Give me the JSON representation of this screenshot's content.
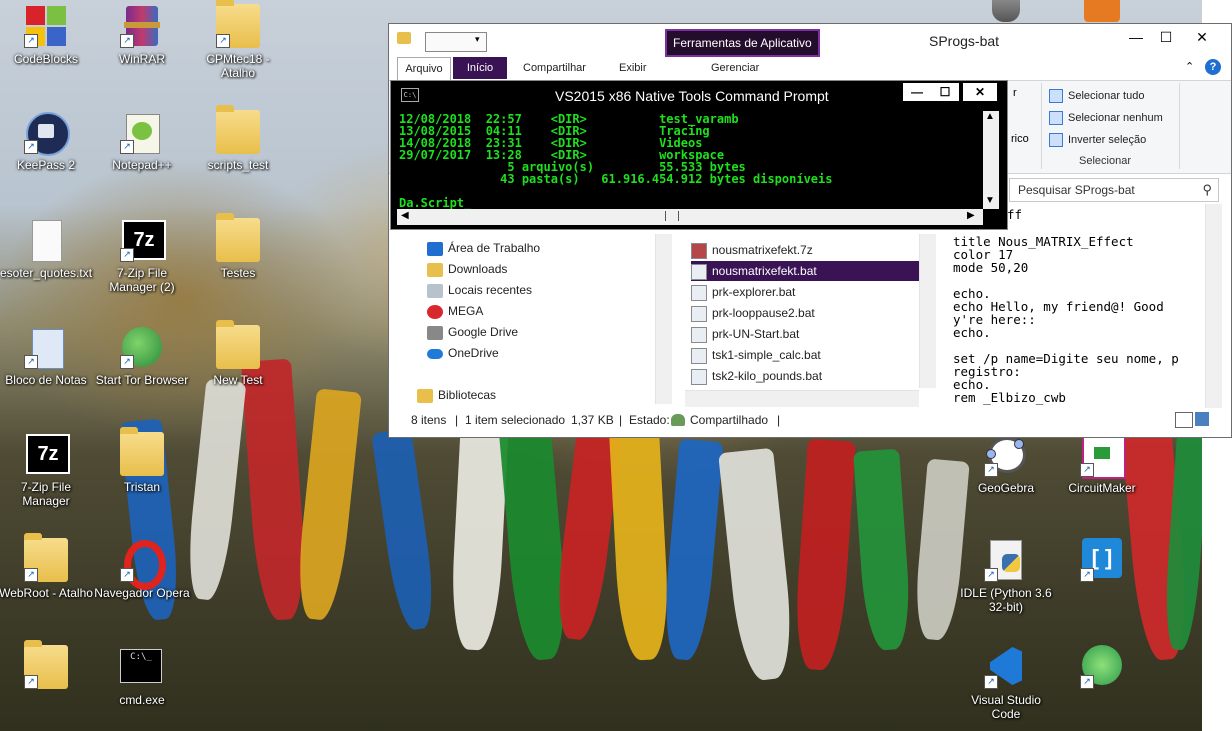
{
  "desktop": {
    "icons": [
      {
        "label": "CodeBlocks"
      },
      {
        "label": "WinRAR"
      },
      {
        "label": "CPMtec18 - Atalho"
      },
      {
        "label": "KeePass 2"
      },
      {
        "label": "Notepad++"
      },
      {
        "label": "scripts_test"
      },
      {
        "label": "esoter_quotes.txt"
      },
      {
        "label": "7-Zip File Manager (2)"
      },
      {
        "label": "Testes"
      },
      {
        "label": "Bloco de Notas"
      },
      {
        "label": "Start Tor Browser"
      },
      {
        "label": "New Test"
      },
      {
        "label": "7-Zip File Manager"
      },
      {
        "label": "Tristan"
      },
      {
        "label": "WebRoot - Atalho"
      },
      {
        "label": "Navegador Opera"
      },
      {
        "label": "cmd.exe"
      },
      {
        "label": "GeoGebra"
      },
      {
        "label": "CircuitMaker"
      },
      {
        "label": "IDLE (Python 3.6 32-bit)"
      },
      {
        "label": "Visual Studio Code"
      }
    ]
  },
  "explorer": {
    "title": "SProgs-bat",
    "tool_tab": "Ferramentas de Aplicativo",
    "tabs": [
      "Arquivo",
      "Início",
      "Compartilhar",
      "Exibir",
      "Gerenciar"
    ],
    "ribbon_select": {
      "select_all": "Selecionar tudo",
      "select_none": "Selecionar nenhum",
      "invert": "Inverter seleção",
      "group": "Selecionar",
      "partial_1": "r",
      "partial_2": "rico"
    },
    "search_placeholder": "Pesquisar SProgs-bat",
    "nav": [
      "Área de Trabalho",
      "Downloads",
      "Locais recentes",
      "MEGA",
      "Google Drive",
      "OneDrive",
      "Bibliotecas"
    ],
    "files": [
      {
        "name": "nousmatrixefekt.7z",
        "selected": false
      },
      {
        "name": "nousmatrixefekt.bat",
        "selected": true
      },
      {
        "name": "prk-explorer.bat",
        "selected": false
      },
      {
        "name": "prk-looppause2.bat",
        "selected": false
      },
      {
        "name": "prk-UN-Start.bat",
        "selected": false
      },
      {
        "name": "tsk1-simple_calc.bat",
        "selected": false
      },
      {
        "name": "tsk2-kilo_pounds.bat",
        "selected": false
      }
    ],
    "preview": [
      "ff",
      "title Nous_MATRIX_Effect",
      "color 17",
      "mode 50,20",
      "",
      "echo.",
      "echo Hello, my friend@! Good",
      "y're here::",
      "echo.",
      "",
      "set /p name=Digite seu nome, p",
      "registro:",
      "echo.",
      "rem _Elbizo_cwb"
    ],
    "status": {
      "items": "8 itens",
      "selected": "1 item selecionado",
      "size": "1,37 KB",
      "state_label": "Estado:",
      "state_value": "Compartilhado"
    }
  },
  "cmd": {
    "title": "VS2015 x86 Native Tools Command Prompt",
    "icon_text": "C:\\",
    "lines": [
      "12/08/2018  22:57    <DIR>          test_varamb",
      "13/08/2015  04:11    <DIR>          Tracing",
      "14/08/2018  23:31    <DIR>          Videos",
      "29/07/2017  13:28    <DIR>          workspace",
      "               5 arquivo(s)         55.533 bytes",
      "              43 pasta(s)   61.916.454.912 bytes disponíveis",
      "",
      "Da.Script_"
    ]
  }
}
